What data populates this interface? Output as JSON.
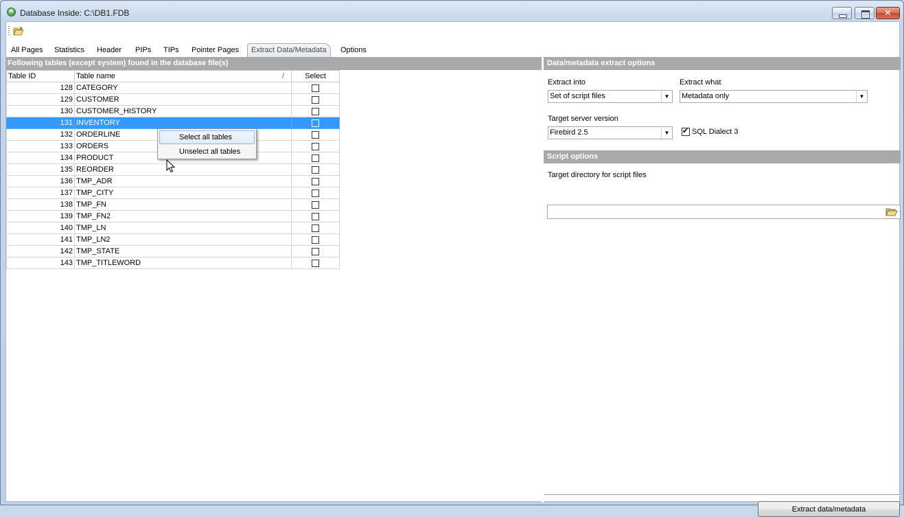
{
  "window": {
    "title": "Database Inside: C:\\DB1.FDB",
    "app_icon_text": "IB"
  },
  "tabs": [
    {
      "label": "All Pages"
    },
    {
      "label": "Statistics"
    },
    {
      "label": "Header"
    },
    {
      "label": "PIPs"
    },
    {
      "label": "TIPs"
    },
    {
      "label": "Pointer Pages"
    },
    {
      "label": "Extract Data/Metadata",
      "active": true
    },
    {
      "label": "Options"
    }
  ],
  "tables_panel": {
    "header": "Following tables (except system) found in the database file(s)",
    "columns": {
      "id": "Table ID",
      "name": "Table name",
      "sort_glyph": "/",
      "select": "Select"
    },
    "rows": [
      {
        "id": "128",
        "name": "CATEGORY"
      },
      {
        "id": "129",
        "name": "CUSTOMER"
      },
      {
        "id": "130",
        "name": "CUSTOMER_HISTORY"
      },
      {
        "id": "131",
        "name": "INVENTORY",
        "selected": true
      },
      {
        "id": "132",
        "name": "ORDERLINE"
      },
      {
        "id": "133",
        "name": "ORDERS"
      },
      {
        "id": "134",
        "name": "PRODUCT"
      },
      {
        "id": "135",
        "name": "REORDER"
      },
      {
        "id": "136",
        "name": "TMP_ADR"
      },
      {
        "id": "137",
        "name": "TMP_CITY"
      },
      {
        "id": "138",
        "name": "TMP_FN"
      },
      {
        "id": "139",
        "name": "TMP_FN2"
      },
      {
        "id": "140",
        "name": "TMP_LN"
      },
      {
        "id": "141",
        "name": "TMP_LN2"
      },
      {
        "id": "142",
        "name": "TMP_STATE"
      },
      {
        "id": "143",
        "name": "TMP_TITLEWORD"
      }
    ]
  },
  "context_menu": {
    "items": [
      {
        "label": "Select all tables",
        "hovered": true
      },
      {
        "label": "Unselect all tables"
      }
    ]
  },
  "extract_options": {
    "header": "Data/metadata extract options",
    "extract_into_label": "Extract into",
    "extract_into_value": "Set of script files",
    "extract_what_label": "Extract what",
    "extract_what_value": "Metadata only",
    "server_version_label": "Target server version",
    "server_version_value": "Firebird 2.5",
    "sql_dialect_label": "SQL Dialect 3",
    "sql_dialect_checked": true
  },
  "script_options": {
    "header": "Script options",
    "target_dir_label": "Target directory for script files",
    "target_dir_value": ""
  },
  "actions": {
    "extract_button": "Extract data/metadata"
  },
  "colors": {
    "selection": "#3399ff",
    "section_header": "#a9a9a9"
  }
}
